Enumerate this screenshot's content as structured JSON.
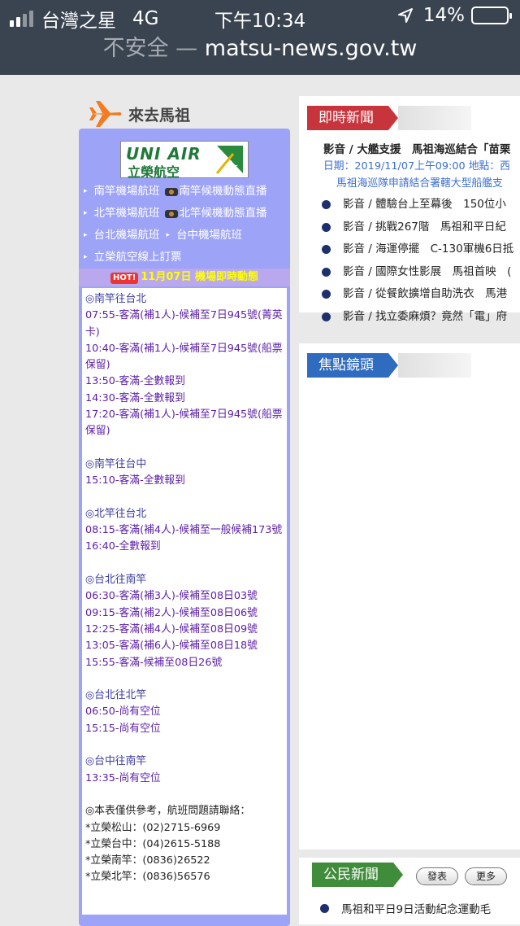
{
  "status": {
    "carrier": "台灣之星",
    "network": "4G",
    "time": "下午10:34",
    "battery": "14%",
    "battery_level": 0.14
  },
  "browser": {
    "insecure_label": "不安全 —",
    "domain": "matsu-news.gov.tw"
  },
  "goto": {
    "title": "來去馬祖"
  },
  "airline": {
    "name_en": "UNI AIR",
    "name_cn": "立榮航空"
  },
  "flight_links": [
    {
      "label": "南竿機場航班",
      "cam_label": "南竿候機動態直播"
    },
    {
      "label": "北竿機場航班",
      "cam_label": "北竿候機動態直播"
    },
    {
      "label": "台北機場航班",
      "second_label": "台中機場航班"
    },
    {
      "label": "立榮航空線上訂票"
    }
  ],
  "hot_bar": {
    "badge": "HOT!",
    "text": "11月07日 機場即時動態"
  },
  "schedule": [
    {
      "heading": "◎南竿往台北",
      "flights": [
        "07:55-客滿(補1人)-候補至7日945號(菁英卡)",
        "10:40-客滿(補1人)-候補至7日945號(船票保留)",
        "13:50-客滿-全數報到",
        "14:30-客滿-全數報到",
        "17:20-客滿(補1人)-候補至7日945號(船票保留)"
      ]
    },
    {
      "heading": "◎南竿往台中",
      "flights": [
        "15:10-客滿-全數報到"
      ]
    },
    {
      "heading": "◎北竿往台北",
      "flights": [
        "08:15-客滿(補4人)-候補至一般候補173號",
        "16:40-全數報到"
      ]
    },
    {
      "heading": "◎台北往南竿",
      "flights": [
        "06:30-客滿(補3人)-候補至08日03號",
        "09:15-客滿(補2人)-候補至08日06號",
        "12:25-客滿(補4人)-候補至08日09號",
        "13:05-客滿(補6人)-候補至08日18號",
        "15:55-客滿-候補至08日26號"
      ]
    },
    {
      "heading": "◎台北往北竿",
      "flights": [
        "06:50-尚有空位",
        "15:15-尚有空位"
      ]
    },
    {
      "heading": "◎台中往南竿",
      "flights": [
        "13:35-尚有空位"
      ]
    }
  ],
  "contact": {
    "heading": "◎本表僅供參考，航班問題請聯絡：",
    "lines": [
      "*立榮松山：(02)2715-6969",
      "*立榮台中：(04)2615-5188",
      "*立榮南竿：(0836)26522",
      "*立榮北竿：(0836)56576"
    ]
  },
  "news": {
    "tab": "即時新聞",
    "main_title": "影音 / 大艦支援　馬祖海巡結合「苗栗",
    "main_date": "日期：2019/11/07上午09:00 地點：西",
    "main_sub": "馬祖海巡隊申請結合署轄大型船艦支",
    "items": [
      "影音 / 體驗台上至幕後　150位小",
      "影音 / 挑戰267階　馬祖和平日紀",
      "影音 / 海運停擺　C-130軍機6日抵",
      "影音 / 國際女性影展　馬祖首映　(",
      "影音 / 從餐飲擴增自助洗衣　馬港",
      "影音 / 找立委麻煩？竟然「電」府"
    ]
  },
  "focus": {
    "tab": "焦點鏡頭"
  },
  "civic": {
    "tab": "公民新聞",
    "post_button": "發表",
    "more_button": "更多",
    "item": "馬祖和平日9日活動紀念運動毛"
  }
}
